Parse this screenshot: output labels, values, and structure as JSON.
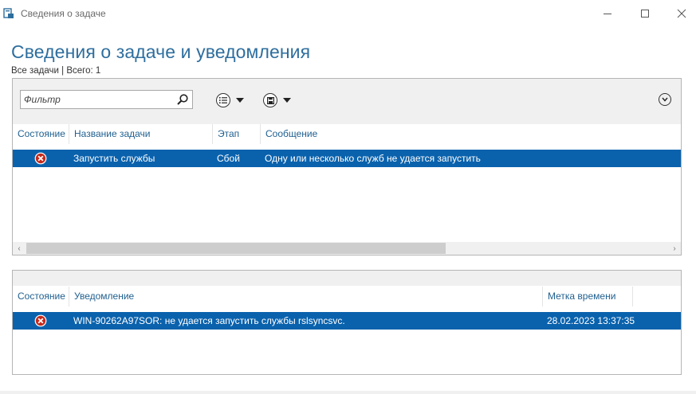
{
  "window": {
    "title": "Сведения о задаче"
  },
  "page": {
    "title": "Сведения о задаче и уведомления",
    "subtitle": "Все задачи | Всего: 1"
  },
  "toolbar": {
    "filter_placeholder": "Фильтр"
  },
  "tasks": {
    "columns": [
      "Состояние",
      "Название задачи",
      "Этап",
      "Сообщение"
    ],
    "rows": [
      {
        "status": "error",
        "name": "Запустить службы",
        "stage": "Сбой",
        "message": "Одну или несколько служб не удается запустить"
      }
    ]
  },
  "notifications": {
    "columns": [
      "Состояние",
      "Уведомление",
      "Метка времени"
    ],
    "rows": [
      {
        "status": "error",
        "text": "WIN-90262A97SOR: не удается запустить службы rslsyncsvc.",
        "timestamp": "28.02.2023 13:37:35"
      }
    ]
  },
  "colors": {
    "accent": "#2e6e9e",
    "header_text": "#1f5f8f",
    "selection": "#0a62ad",
    "error": "#c42b1c"
  }
}
